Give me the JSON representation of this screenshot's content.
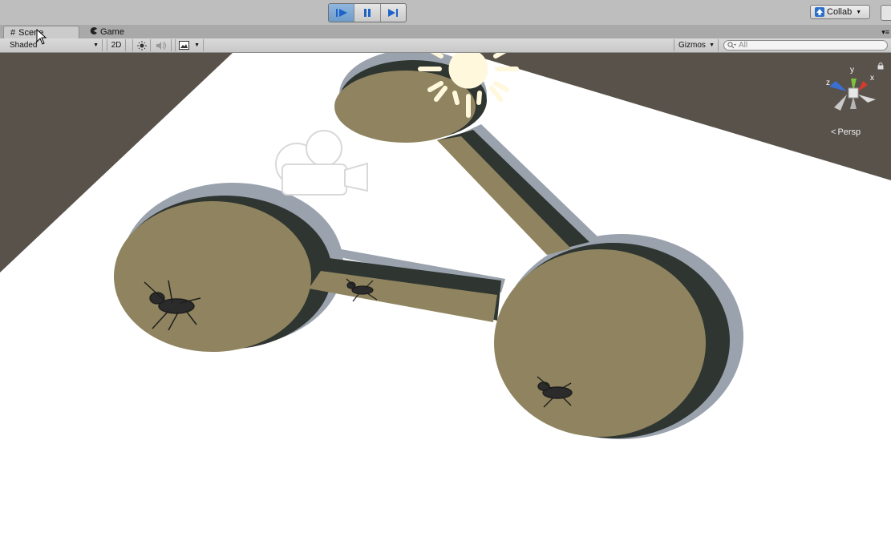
{
  "toolbar": {
    "play_icon": "play-icon",
    "pause_icon": "pause-icon",
    "step_icon": "step-icon",
    "collab_label": "Collab",
    "colors": {
      "active_play": "#7aa6d4",
      "icon_blue": "#1e63c8"
    }
  },
  "tabs": [
    {
      "label": "Scene",
      "icon": "scene-grid-icon"
    },
    {
      "label": "Game",
      "icon": "game-pacman-icon"
    }
  ],
  "scene_toolbar": {
    "shading_mode": "Shaded",
    "mode_2d": "2D",
    "lighting_icon": "sun-icon",
    "audio_icon": "speaker-icon",
    "effects_icon": "image-icon",
    "gizmos_label": "Gizmos",
    "search_placeholder": "All"
  },
  "viewport": {
    "projection_label": "Persp",
    "axis_labels": {
      "x": "x",
      "y": "y",
      "z": "z"
    },
    "objects": [
      "directional-light-icon",
      "camera-icon",
      "ant-left-chamber",
      "ant-tunnel",
      "ant-right-chamber"
    ],
    "colors": {
      "background": "#59524b",
      "ground": "#ffffff",
      "floor": "#8f845f",
      "wall_shadow": "#2f3530",
      "wall_top": "#9aa2ad",
      "gizmo_icon": "#fff8dc"
    }
  }
}
